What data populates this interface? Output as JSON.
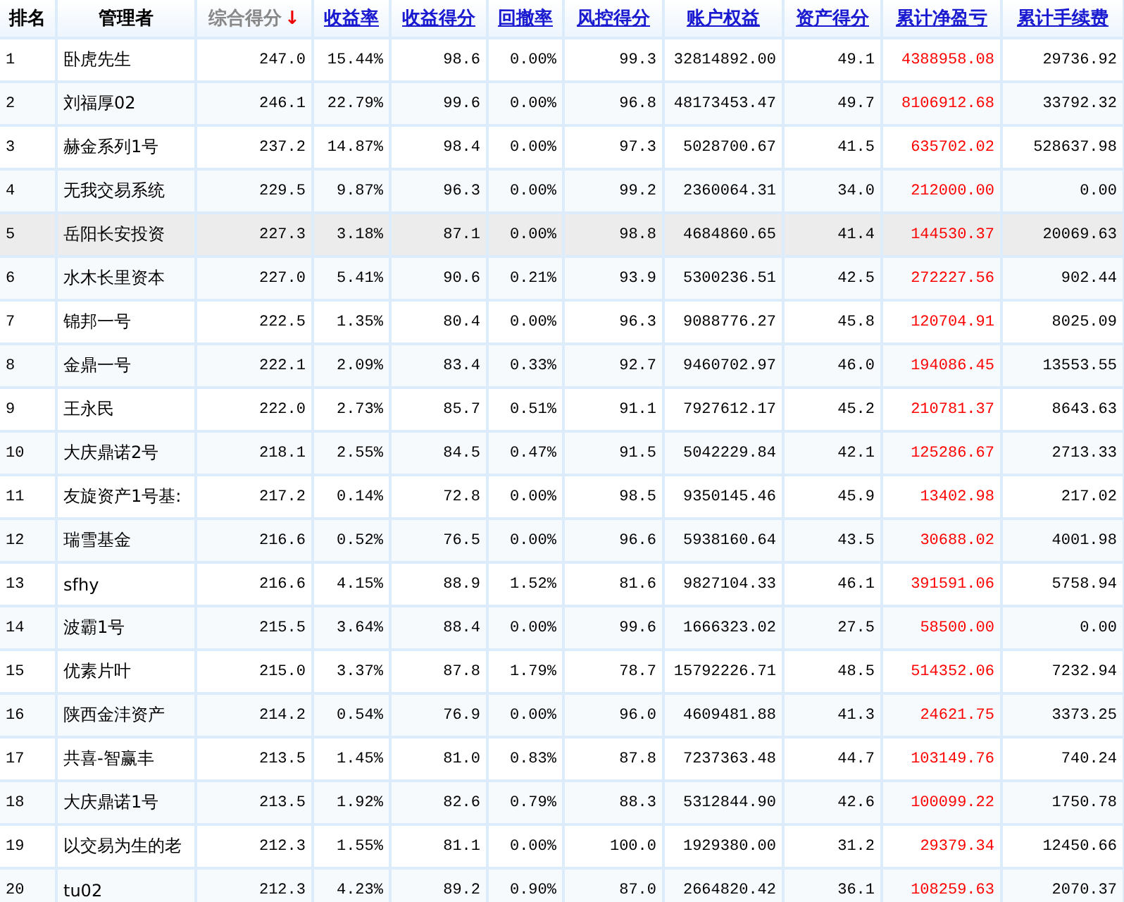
{
  "table": {
    "columns": [
      {
        "label": "排名",
        "kind": "plain"
      },
      {
        "label": "管理者",
        "kind": "plain"
      },
      {
        "label": "综合得分",
        "kind": "sorted",
        "sort_icon": "↓"
      },
      {
        "label": "收益率",
        "kind": "link"
      },
      {
        "label": "收益得分",
        "kind": "link"
      },
      {
        "label": "回撤率",
        "kind": "link"
      },
      {
        "label": "风控得分",
        "kind": "link"
      },
      {
        "label": "账户权益",
        "kind": "link"
      },
      {
        "label": "资产得分",
        "kind": "link"
      },
      {
        "label": "累计净盈亏",
        "kind": "link",
        "color": "#ff0000"
      },
      {
        "label": "累计手续费",
        "kind": "link"
      }
    ],
    "rows": [
      {
        "selected": false,
        "cells": [
          "1",
          "卧虎先生",
          "247.0",
          "15.44%",
          "98.6",
          "0.00%",
          "99.3",
          "32814892.00",
          "49.1",
          "4388958.08",
          "29736.92"
        ]
      },
      {
        "selected": false,
        "cells": [
          "2",
          "刘福厚02",
          "246.1",
          "22.79%",
          "99.6",
          "0.00%",
          "96.8",
          "48173453.47",
          "49.7",
          "8106912.68",
          "33792.32"
        ]
      },
      {
        "selected": false,
        "cells": [
          "3",
          "赫金系列1号",
          "237.2",
          "14.87%",
          "98.4",
          "0.00%",
          "97.3",
          "5028700.67",
          "41.5",
          "635702.02",
          "528637.98"
        ]
      },
      {
        "selected": false,
        "cells": [
          "4",
          "无我交易系统",
          "229.5",
          "9.87%",
          "96.3",
          "0.00%",
          "99.2",
          "2360064.31",
          "34.0",
          "212000.00",
          "0.00"
        ]
      },
      {
        "selected": true,
        "cells": [
          "5",
          "岳阳长安投资",
          "227.3",
          "3.18%",
          "87.1",
          "0.00%",
          "98.8",
          "4684860.65",
          "41.4",
          "144530.37",
          "20069.63"
        ]
      },
      {
        "selected": false,
        "cells": [
          "6",
          "水木长里资本",
          "227.0",
          "5.41%",
          "90.6",
          "0.21%",
          "93.9",
          "5300236.51",
          "42.5",
          "272227.56",
          "902.44"
        ]
      },
      {
        "selected": false,
        "cells": [
          "7",
          "锦邦一号",
          "222.5",
          "1.35%",
          "80.4",
          "0.00%",
          "96.3",
          "9088776.27",
          "45.8",
          "120704.91",
          "8025.09"
        ]
      },
      {
        "selected": false,
        "cells": [
          "8",
          "金鼎一号",
          "222.1",
          "2.09%",
          "83.4",
          "0.33%",
          "92.7",
          "9460702.97",
          "46.0",
          "194086.45",
          "13553.55"
        ]
      },
      {
        "selected": false,
        "cells": [
          "9",
          "王永民",
          "222.0",
          "2.73%",
          "85.7",
          "0.51%",
          "91.1",
          "7927612.17",
          "45.2",
          "210781.37",
          "8643.63"
        ]
      },
      {
        "selected": false,
        "cells": [
          "10",
          "大庆鼎诺2号",
          "218.1",
          "2.55%",
          "84.5",
          "0.47%",
          "91.5",
          "5042229.84",
          "42.1",
          "125286.67",
          "2713.33"
        ]
      },
      {
        "selected": false,
        "cells": [
          "11",
          "友旋资产1号基:",
          "217.2",
          "0.14%",
          "72.8",
          "0.00%",
          "98.5",
          "9350145.46",
          "45.9",
          "13402.98",
          "217.02"
        ]
      },
      {
        "selected": false,
        "cells": [
          "12",
          "瑞雪基金",
          "216.6",
          "0.52%",
          "76.5",
          "0.00%",
          "96.6",
          "5938160.64",
          "43.5",
          "30688.02",
          "4001.98"
        ]
      },
      {
        "selected": false,
        "cells": [
          "13",
          "sfhy",
          "216.6",
          "4.15%",
          "88.9",
          "1.52%",
          "81.6",
          "9827104.33",
          "46.1",
          "391591.06",
          "5758.94"
        ]
      },
      {
        "selected": false,
        "cells": [
          "14",
          "波霸1号",
          "215.5",
          "3.64%",
          "88.4",
          "0.00%",
          "99.6",
          "1666323.02",
          "27.5",
          "58500.00",
          "0.00"
        ]
      },
      {
        "selected": false,
        "cells": [
          "15",
          "优素片叶",
          "215.0",
          "3.37%",
          "87.8",
          "1.79%",
          "78.7",
          "15792226.71",
          "48.5",
          "514352.06",
          "7232.94"
        ]
      },
      {
        "selected": false,
        "cells": [
          "16",
          "陕西金沣资产",
          "214.2",
          "0.54%",
          "76.9",
          "0.00%",
          "96.0",
          "4609481.88",
          "41.3",
          "24621.75",
          "3373.25"
        ]
      },
      {
        "selected": false,
        "cells": [
          "17",
          "共喜-智赢丰",
          "213.5",
          "1.45%",
          "81.0",
          "0.83%",
          "87.8",
          "7237363.48",
          "44.7",
          "103149.76",
          "740.24"
        ]
      },
      {
        "selected": false,
        "cells": [
          "18",
          "大庆鼎诺1号",
          "213.5",
          "1.92%",
          "82.6",
          "0.79%",
          "88.3",
          "5312844.90",
          "42.6",
          "100099.22",
          "1750.78"
        ]
      },
      {
        "selected": false,
        "cells": [
          "19",
          "以交易为生的老",
          "212.3",
          "1.55%",
          "81.1",
          "0.00%",
          "100.0",
          "1929380.00",
          "31.2",
          "29379.34",
          "12450.66"
        ]
      },
      {
        "selected": false,
        "cells": [
          "20",
          "tu02",
          "212.3",
          "4.23%",
          "89.2",
          "0.90%",
          "87.0",
          "2664820.42",
          "36.1",
          "108259.63",
          "2070.37"
        ]
      }
    ]
  }
}
